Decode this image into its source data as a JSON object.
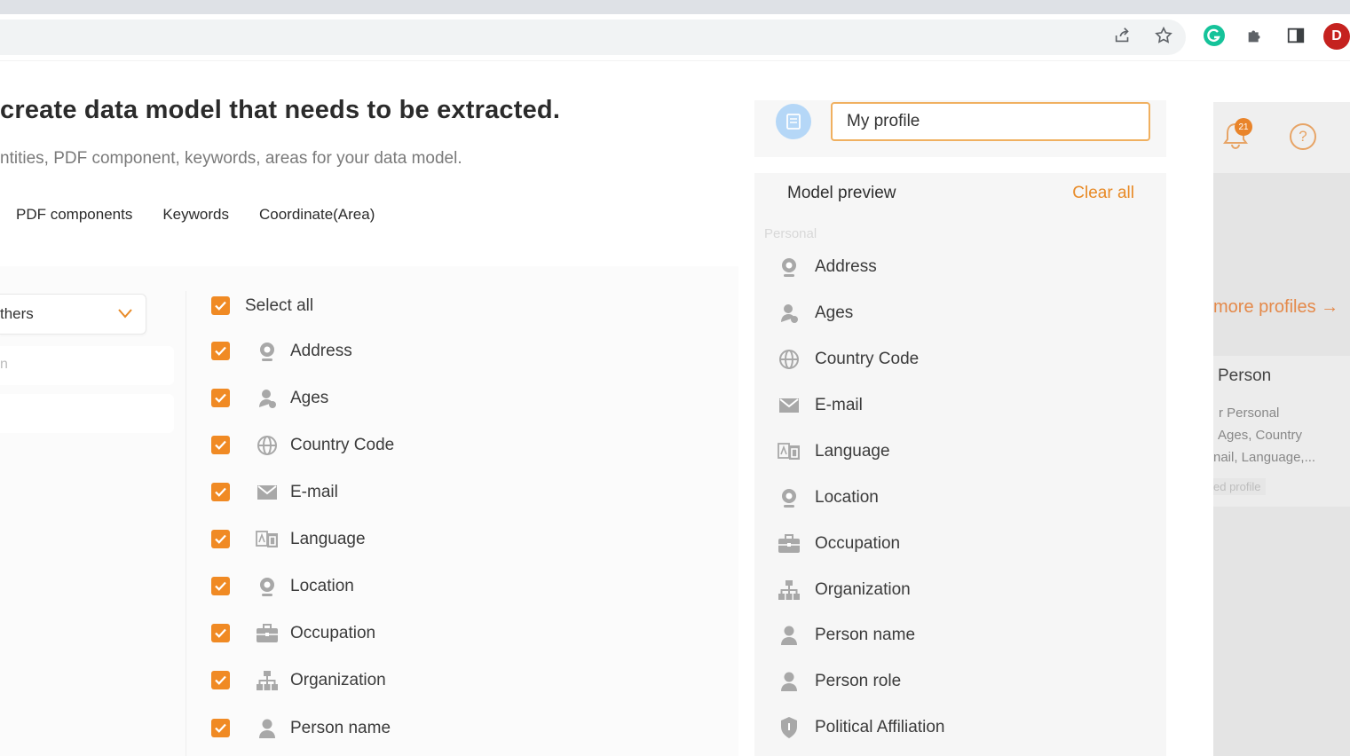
{
  "header": {
    "title": "create data model that needs to be extracted.",
    "subtitle": "ntities, PDF component, keywords, areas for your data model."
  },
  "tabs": [
    {
      "label": "PDF components"
    },
    {
      "label": "Keywords"
    },
    {
      "label": "Coordinate(Area)"
    }
  ],
  "filter": {
    "dropdown_value": "thers",
    "search_placeholder": "n"
  },
  "entities": {
    "select_all_label": "Select all",
    "items": [
      {
        "label": "Address",
        "icon": "location-pin-icon"
      },
      {
        "label": "Ages",
        "icon": "person-age-icon"
      },
      {
        "label": "Country Code",
        "icon": "globe-icon"
      },
      {
        "label": "E-mail",
        "icon": "mail-icon"
      },
      {
        "label": "Language",
        "icon": "language-icon"
      },
      {
        "label": "Location",
        "icon": "location-pin-icon"
      },
      {
        "label": "Occupation",
        "icon": "briefcase-icon"
      },
      {
        "label": "Organization",
        "icon": "org-chart-icon"
      },
      {
        "label": "Person name",
        "icon": "person-icon"
      }
    ]
  },
  "profile": {
    "name_value": "My profile"
  },
  "preview": {
    "title": "Model preview",
    "clear_label": "Clear all",
    "group_label": "Personal",
    "items": [
      {
        "label": "Address",
        "icon": "location-pin-icon"
      },
      {
        "label": "Ages",
        "icon": "person-age-icon"
      },
      {
        "label": "Country Code",
        "icon": "globe-icon"
      },
      {
        "label": "E-mail",
        "icon": "mail-icon"
      },
      {
        "label": "Language",
        "icon": "language-icon"
      },
      {
        "label": "Location",
        "icon": "location-pin-icon"
      },
      {
        "label": "Occupation",
        "icon": "briefcase-icon"
      },
      {
        "label": "Organization",
        "icon": "org-chart-icon"
      },
      {
        "label": "Person name",
        "icon": "person-icon"
      },
      {
        "label": "Person role",
        "icon": "person-icon"
      },
      {
        "label": "Political Affiliation",
        "icon": "shield-icon"
      }
    ]
  },
  "side": {
    "notification_count": "21",
    "help_label": "?",
    "more_profiles_label": "more profiles →",
    "person_card": {
      "title": "Person",
      "desc_line1": "r Personal",
      "desc_line2": "Ages, Country",
      "desc_line3": "nail, Language,...",
      "tag": "ed profile"
    }
  },
  "browser": {
    "avatar_letter": "D"
  },
  "colors": {
    "accent": "#f08a24",
    "link": "#e88a26",
    "input_border": "#f0b060",
    "icon_gray": "#9a9a9a"
  }
}
